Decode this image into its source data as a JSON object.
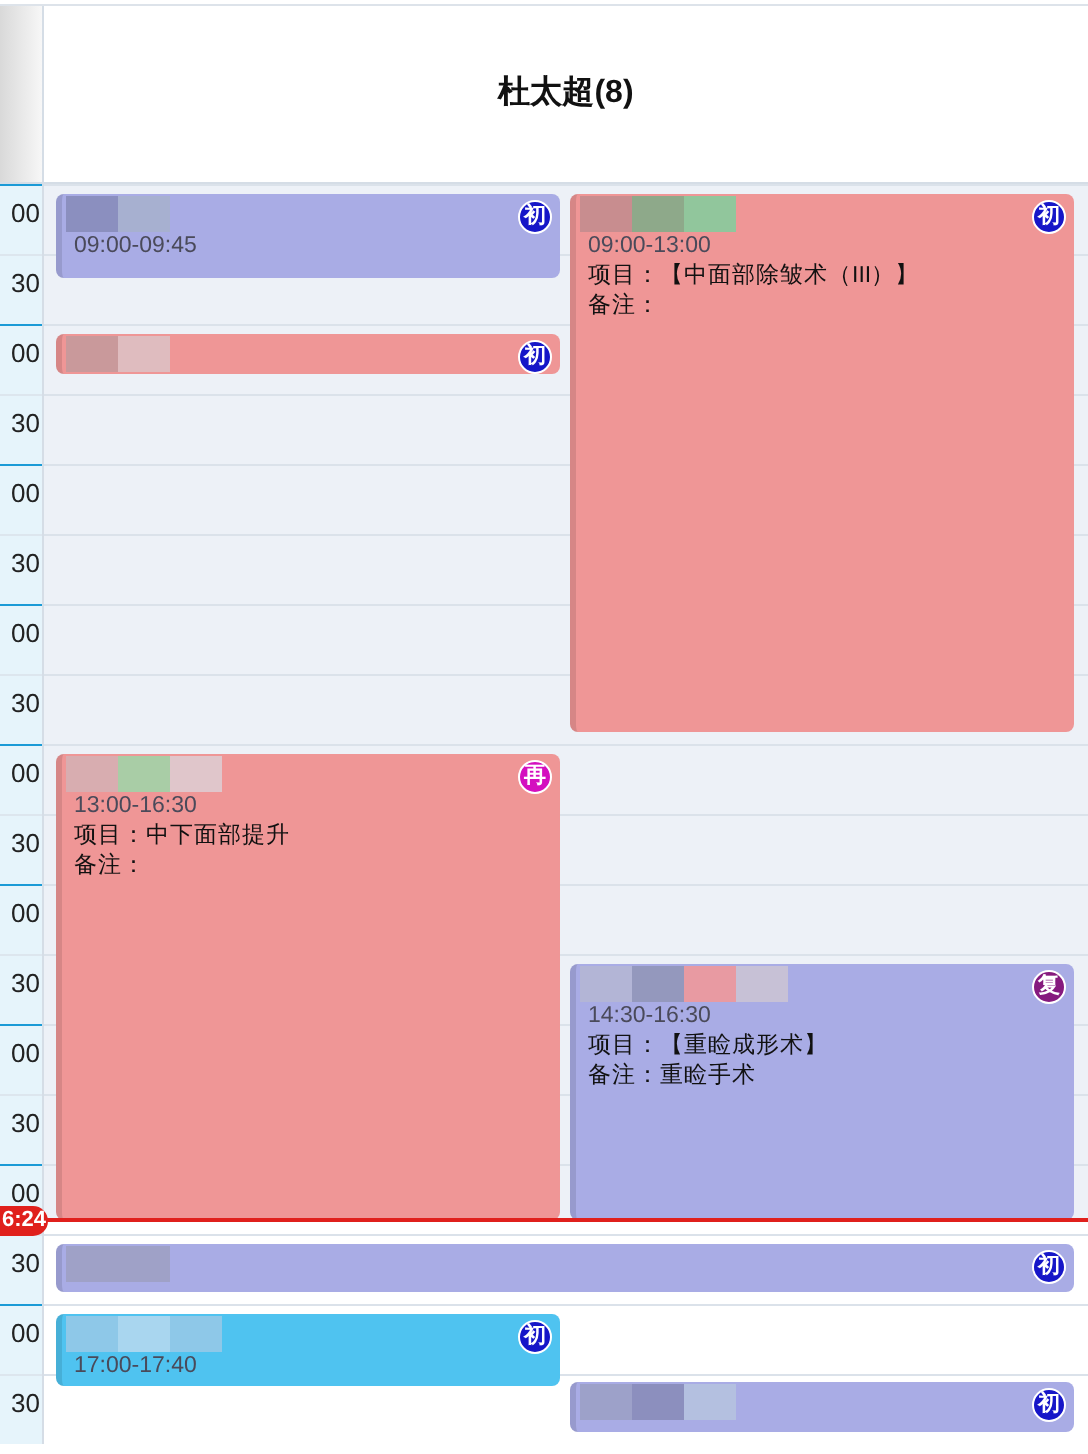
{
  "header": {
    "title": "杜太超(8)"
  },
  "rows": [
    {
      "label": "00"
    },
    {
      "label": "30"
    },
    {
      "label": "00"
    },
    {
      "label": "30"
    },
    {
      "label": "00"
    },
    {
      "label": "30"
    },
    {
      "label": "00"
    },
    {
      "label": "30"
    },
    {
      "label": "00"
    },
    {
      "label": "30"
    },
    {
      "label": "00"
    },
    {
      "label": "30"
    },
    {
      "label": "00"
    },
    {
      "label": "30"
    },
    {
      "label": "00"
    },
    {
      "label": "30"
    },
    {
      "label": "00"
    },
    {
      "label": "30"
    }
  ],
  "current_time": "6:24",
  "events": [
    {
      "kind": "first",
      "color": "#a9ace5",
      "badge": "初",
      "time": "09:00-09:45"
    },
    {
      "kind": "first",
      "color": "#ef9696",
      "badge": "初",
      "time": "09:00-13:00",
      "project": "项目：【中面部除皱术（III）】",
      "note": "备注："
    },
    {
      "kind": "first",
      "color": "#ef9696",
      "badge": "初"
    },
    {
      "kind": "again",
      "color": "#ef9696",
      "badge": "再",
      "time": "13:00-16:30",
      "project": "项目：中下面部提升",
      "note": "备注："
    },
    {
      "kind": "review",
      "color": "#a9ace5",
      "badge": "复",
      "time": "14:30-16:30",
      "project": "项目：【重睑成形术】",
      "note": "备注：重睑手术"
    },
    {
      "kind": "first",
      "color": "#a9ace5",
      "badge": "初"
    },
    {
      "kind": "first",
      "color": "#4fc3f0",
      "badge": "初",
      "time": "17:00-17:40"
    },
    {
      "kind": "first",
      "color": "#a9ace5",
      "badge": "初"
    }
  ]
}
